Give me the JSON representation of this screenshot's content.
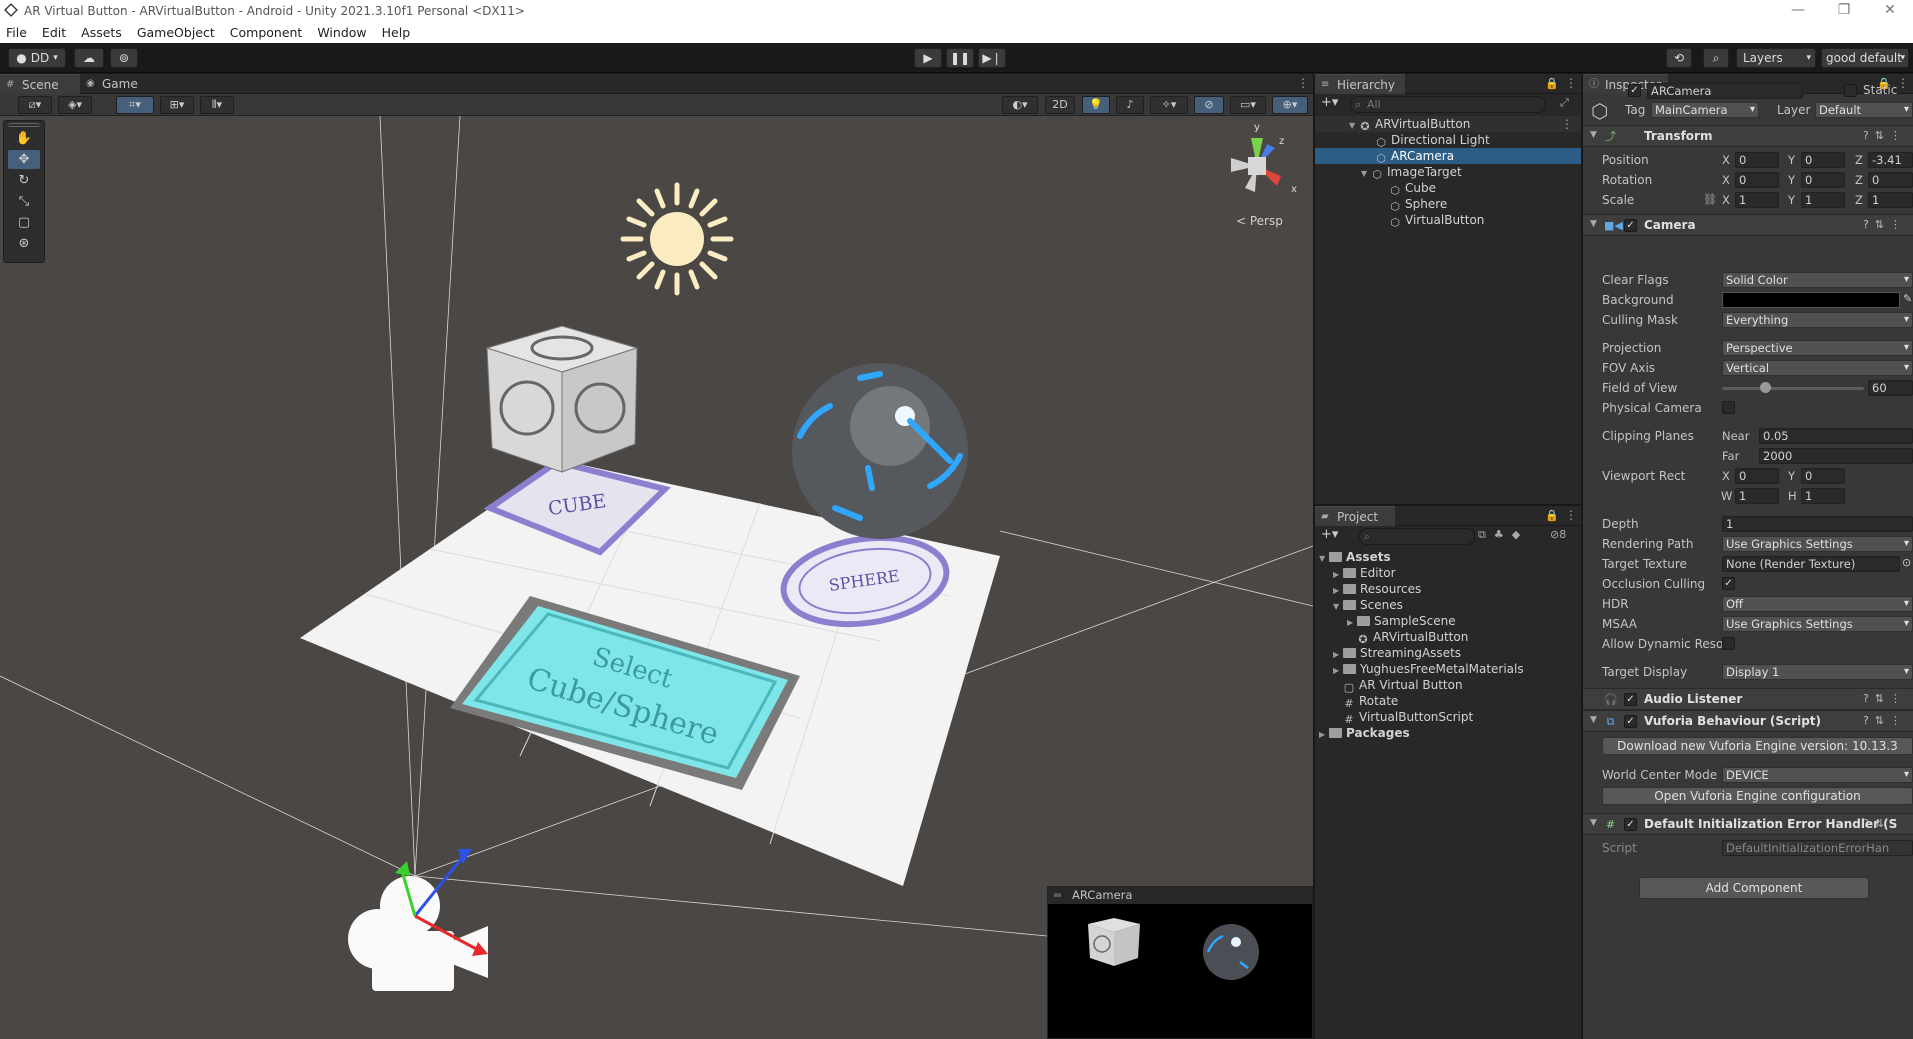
{
  "window": {
    "title": "AR Virtual Button - ARVirtualButton - Android - Unity 2021.3.10f1 Personal <DX11>",
    "minimize": "—",
    "maximize": "❐",
    "close": "✕"
  },
  "menu": [
    "File",
    "Edit",
    "Assets",
    "GameObject",
    "Component",
    "Window",
    "Help"
  ],
  "toolbar": {
    "account": "DD",
    "layers": "Layers",
    "layout": "good default"
  },
  "scene": {
    "tabs": [
      "Scene",
      "Game"
    ],
    "mode2d": "2D",
    "persp": "< Persp",
    "gizmo_y": "y",
    "gizmo_x": "x",
    "gizmo_z": "z",
    "cube_label": "CUBE",
    "sphere_label": "SPHERE",
    "select_line1": "Select",
    "select_line2": "Cube/Sphere",
    "preview_title": "ARCamera"
  },
  "hierarchy": {
    "title": "Hierarchy",
    "search": "All",
    "items": [
      "ARVirtualButton",
      "Directional Light",
      "ARCamera",
      "ImageTarget",
      "Cube",
      "Sphere",
      "VirtualButton"
    ]
  },
  "project": {
    "title": "Project",
    "count": "8",
    "items": [
      "Assets",
      "Editor",
      "Resources",
      "Scenes",
      "SampleScene",
      "ARVirtualButton",
      "StreamingAssets",
      "YughuesFreeMetalMaterials",
      "AR Virtual Button",
      "Rotate",
      "VirtualButtonScript",
      "Packages"
    ]
  },
  "inspector": {
    "title": "Inspector",
    "object_name": "ARCamera",
    "static": "Static",
    "tag_label": "Tag",
    "tag": "MainCamera",
    "layer_label": "Layer",
    "layer": "Default",
    "transform": {
      "title": "Transform",
      "position": "Position",
      "rotation": "Rotation",
      "scale": "Scale",
      "pos": [
        "0",
        "0",
        "-3.41"
      ],
      "rot": [
        "0",
        "0",
        "0"
      ],
      "scl": [
        "1",
        "1",
        "1"
      ]
    },
    "camera": {
      "title": "Camera",
      "clear_flags": "Clear Flags",
      "clear_flags_v": "Solid Color",
      "background": "Background",
      "culling": "Culling Mask",
      "culling_v": "Everything",
      "projection": "Projection",
      "projection_v": "Perspective",
      "fov_axis": "FOV Axis",
      "fov_axis_v": "Vertical",
      "fov": "Field of View",
      "fov_v": "60",
      "fov_fraction": 0.3,
      "physical": "Physical Camera",
      "clipping": "Clipping Planes",
      "near": "Near",
      "near_v": "0.05",
      "far": "Far",
      "far_v": "2000",
      "viewport": "Viewport Rect",
      "vx": "0",
      "vy": "0",
      "vw": "1",
      "vh": "1",
      "depth": "Depth",
      "depth_v": "1",
      "rpath": "Rendering Path",
      "rpath_v": "Use Graphics Settings",
      "ttex": "Target Texture",
      "ttex_v": "None (Render Texture)",
      "occ": "Occlusion Culling",
      "hdr": "HDR",
      "hdr_v": "Off",
      "msaa": "MSAA",
      "msaa_v": "Use Graphics Settings",
      "dyn": "Allow Dynamic Resol",
      "tdisp": "Target Display",
      "tdisp_v": "Display 1"
    },
    "audio": "Audio Listener",
    "vuforia": {
      "title": "Vuforia Behaviour (Script)",
      "download": "Download new Vuforia Engine version: 10.13.3",
      "wcm": "World Center Mode",
      "wcm_v": "DEVICE",
      "open": "Open Vuforia Engine configuration"
    },
    "handler": {
      "title": "Default Initialization Error Handler (S",
      "script": "Script",
      "script_v": "DefaultInitializationErrorHan"
    },
    "add": "Add Component"
  }
}
